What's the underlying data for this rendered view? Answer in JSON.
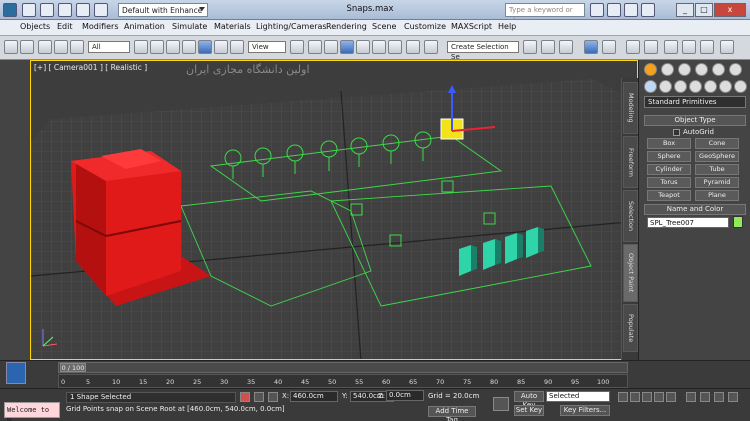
{
  "titlebar": {
    "workspace": "Default with Enhance",
    "document_title": "Snaps.max",
    "search_placeholder": "Type a keyword or phrase",
    "min": "_",
    "max": "□",
    "close": "x"
  },
  "menu": [
    "Objects",
    "Edit",
    "Modifiers",
    "Animation",
    "Simulate",
    "Materials",
    "Lighting/Cameras",
    "Rendering",
    "Scene",
    "Customize",
    "MAXScript",
    "Help"
  ],
  "toolbar": {
    "filter": "All",
    "refcoord": "View",
    "selection_set": "Create Selection Se"
  },
  "viewport": {
    "label": "[+] [ Camera001 ] [ Realistic ]",
    "watermark": "اولین دانشگاه مجازی ایران",
    "accent": "#ffd600"
  },
  "tabs": [
    "Modeling",
    "Freeform",
    "Selection",
    "Object Paint",
    "Populate"
  ],
  "command_panel": {
    "category": "Standard Primitives",
    "object_type_title": "Object Type",
    "autogrid": "AutoGrid",
    "primitives": [
      "Box",
      "Cone",
      "Sphere",
      "GeoSphere",
      "Cylinder",
      "Tube",
      "Torus",
      "Pyramid",
      "Teapot",
      "Plane"
    ],
    "name_color_title": "Name and Color",
    "object_name": "SPL_Tree007",
    "object_color": "#8fea5c"
  },
  "timeline": {
    "frame": "0 / 100",
    "ticks": [
      "0",
      "5",
      "10",
      "15",
      "20",
      "25",
      "30",
      "35",
      "40",
      "45",
      "50",
      "55",
      "60",
      "65",
      "70",
      "75",
      "80",
      "85",
      "90",
      "95",
      "100"
    ]
  },
  "status": {
    "welcome": "Welcome to M",
    "selection": "1 Shape Selected",
    "prompt": "Grid Points snap on Scene Root at [460.0cm, 540.0cm, 0.0cm]",
    "x_label": "X:",
    "x": "460.0cm",
    "y_label": "Y:",
    "y": "540.0cm",
    "z_label": "Z:",
    "z": "0.0cm",
    "grid": "Grid = 20.0cm",
    "add_time_tag": "Add Time Tag",
    "auto_key": "Auto Key",
    "key_mode": "Selected",
    "set_key": "Set Key",
    "key_filters": "Key Filters..."
  }
}
